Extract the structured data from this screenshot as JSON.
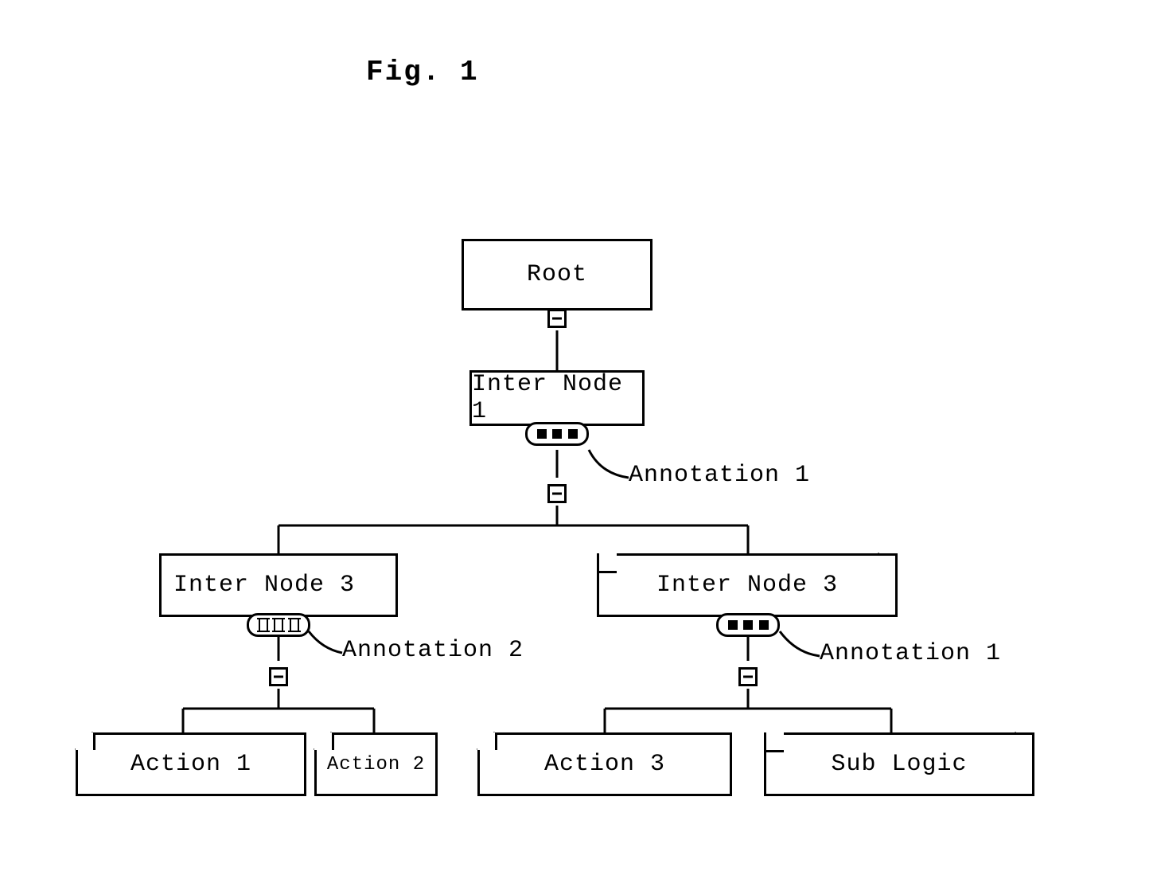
{
  "title": "Fig. 1",
  "nodes": {
    "root": "Root",
    "inter1": "Inter Node 1",
    "inter3_left": "Inter Node 3",
    "inter3_right": "Inter Node 3",
    "action1": "Action 1",
    "action2": "Action 2",
    "action3": "Action 3",
    "sublogic": "Sub Logic"
  },
  "annotations": {
    "a1": "Annotation 1",
    "a2": "Annotation 2",
    "a3": "Annotation 1"
  },
  "diagram": {
    "type": "tree",
    "description": "Behavior-tree style hierarchy. Root node has one child Inter Node 1 (marked Annotation 1). Inter Node 1 has two children: left Inter Node 3 (marked Annotation 2) and right Inter Node 3 (folded-corner, marked Annotation 1). Left Inter Node 3 has two action leaves Action 1 and Action 2 (cut-corner boxes). Right Inter Node 3 has an action leaf Action 3 (cut-corner) and a Sub Logic leaf (folded-corner).",
    "edges": [
      [
        "root",
        "inter1"
      ],
      [
        "inter1",
        "inter3_left"
      ],
      [
        "inter1",
        "inter3_right"
      ],
      [
        "inter3_left",
        "action1"
      ],
      [
        "inter3_left",
        "action2"
      ],
      [
        "inter3_right",
        "action3"
      ],
      [
        "inter3_right",
        "sublogic"
      ]
    ]
  }
}
